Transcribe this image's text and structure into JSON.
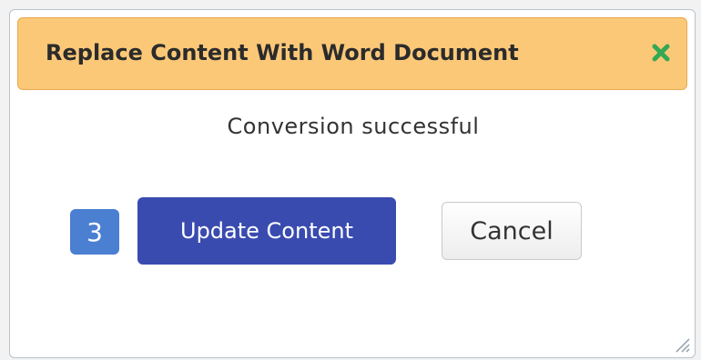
{
  "dialog": {
    "title": "Replace Content With Word Document",
    "close_icon": "close-icon",
    "status_message": "Conversion successful",
    "step_number": "3",
    "update_label": "Update Content",
    "cancel_label": "Cancel"
  },
  "colors": {
    "title_bg": "#fbc878",
    "close_icon": "#34a853",
    "badge_bg": "#4a7fd1",
    "primary_btn": "#3a4bb0"
  }
}
